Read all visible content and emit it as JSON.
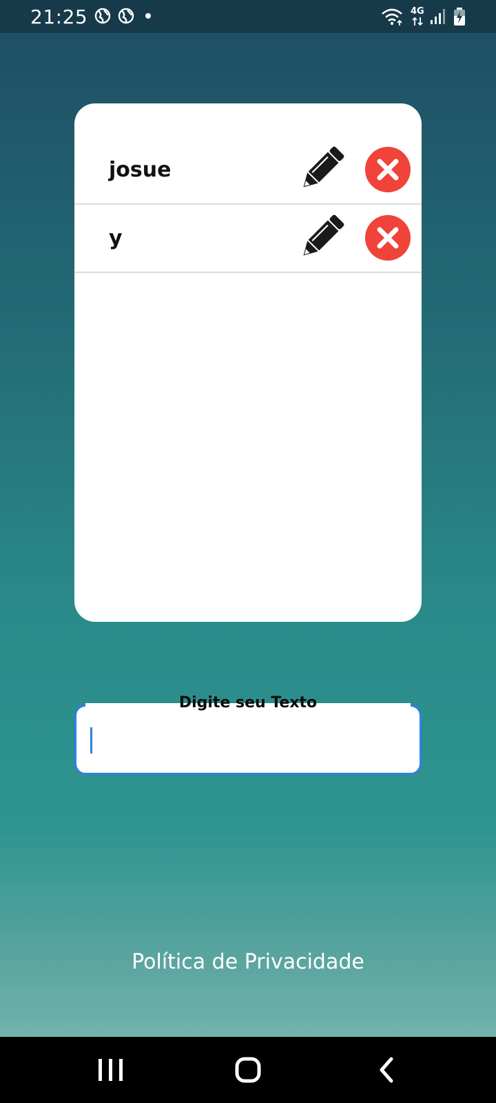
{
  "status_bar": {
    "time": "21:25",
    "network_type": "4G",
    "icons": [
      "globe-icon",
      "globe-icon",
      "notification-dot-icon",
      "wifi-icon",
      "mobile-data-icon",
      "signal-icon",
      "battery-charging-icon"
    ]
  },
  "list": {
    "items": [
      {
        "text": "josue",
        "edit_icon": "pencil-icon",
        "delete_icon": "close-icon"
      },
      {
        "text": "y",
        "edit_icon": "pencil-icon",
        "delete_icon": "close-icon"
      }
    ]
  },
  "input": {
    "label": "Digite seu Texto",
    "value": ""
  },
  "footer": {
    "privacy_link": "Política de Privacidade"
  },
  "nav": {
    "icons": [
      "recent-apps-icon",
      "home-icon",
      "back-icon"
    ]
  },
  "colors": {
    "delete": "#f0433a",
    "focus": "#2f80e0",
    "bg_top": "#1d4d62",
    "bg_bottom": "#72b3ad"
  }
}
